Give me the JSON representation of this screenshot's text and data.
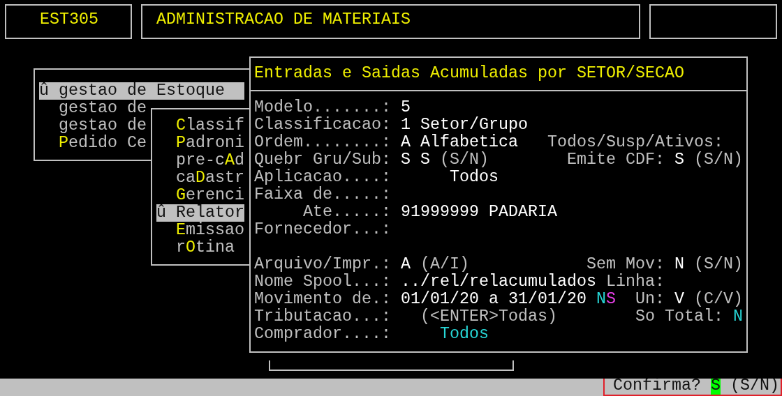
{
  "header": {
    "program_code": "EST305",
    "system_title": "ADMINISTRACAO DE MATERIAIS"
  },
  "main_menu": {
    "items": [
      {
        "selected": true,
        "marker": "û",
        "text": "gestao de Estoque"
      },
      {
        "selected": false,
        "text": "gestao de"
      },
      {
        "selected": false,
        "text": "gestao de"
      },
      {
        "selected": false,
        "key": "P",
        "text": "edido Ce"
      }
    ]
  },
  "sub_menu": {
    "items": [
      {
        "selected": false,
        "key": "C",
        "text": "lassif"
      },
      {
        "selected": false,
        "key": "P",
        "text": "adroni"
      },
      {
        "selected": false,
        "before": "pre-c",
        "key": "A",
        "text": "d"
      },
      {
        "selected": false,
        "before": "ca",
        "key": "D",
        "text": "astr"
      },
      {
        "selected": false,
        "key": "G",
        "text": "erenci"
      },
      {
        "selected": true,
        "marker": "û",
        "text": "Relator"
      },
      {
        "selected": false,
        "key": "E",
        "text": "missao"
      },
      {
        "selected": false,
        "before": "r",
        "key": "O",
        "text": "tina"
      }
    ]
  },
  "dialog": {
    "title": "Entradas e Saidas Acumuladas por SETOR/SECAO",
    "sections": [
      {
        "rows": [
          {
            "segments": [
              {
                "kind": "label",
                "text": "Modelo.......:"
              },
              {
                "kind": "value",
                "text": "5"
              }
            ]
          },
          {
            "segments": [
              {
                "kind": "label",
                "text": "Classificacao:"
              },
              {
                "kind": "value",
                "text": "1 Setor/Grupo"
              }
            ]
          },
          {
            "segments": [
              {
                "kind": "label",
                "text": "Ordem........:"
              },
              {
                "kind": "value",
                "text": "A Alfabetica"
              },
              {
                "kind": "label",
                "text": "Todos/Susp/Ativos:"
              }
            ]
          },
          {
            "segments": [
              {
                "kind": "label",
                "text": "Quebr Gru/Sub:"
              },
              {
                "kind": "value",
                "text": "S S"
              },
              {
                "kind": "hint",
                "text": "(S/N)"
              },
              {
                "kind": "label",
                "text": "Emite CDF:"
              },
              {
                "kind": "value",
                "text": "S"
              },
              {
                "kind": "hint",
                "text": "(S/N)"
              }
            ]
          },
          {
            "segments": [
              {
                "kind": "label",
                "text": "Aplicacao....:"
              },
              {
                "kind": "value",
                "text": "Todos"
              }
            ]
          },
          {
            "segments": [
              {
                "kind": "label",
                "text": "Faixa de.....:"
              }
            ]
          },
          {
            "segments": [
              {
                "kind": "label",
                "text": "Ate.....:"
              },
              {
                "kind": "value",
                "text": "91999999 PADARIA"
              }
            ]
          },
          {
            "segments": [
              {
                "kind": "label",
                "text": "Fornecedor...:"
              }
            ]
          }
        ]
      },
      {
        "rows": [
          {
            "segments": [
              {
                "kind": "label",
                "text": "Arquivo/Impr.:"
              },
              {
                "kind": "value",
                "text": "A"
              },
              {
                "kind": "hint",
                "text": "(A/I)"
              },
              {
                "kind": "label",
                "text": "Sem Mov:"
              },
              {
                "kind": "value",
                "text": "N"
              },
              {
                "kind": "hint",
                "text": "(S/N)"
              }
            ]
          },
          {
            "segments": [
              {
                "kind": "label",
                "text": "Nome Spool...:"
              },
              {
                "kind": "value",
                "text": "../rel/relacumulados"
              },
              {
                "kind": "label",
                "text": "Linha:"
              }
            ]
          },
          {
            "segments": [
              {
                "kind": "label",
                "text": "Movimento de.:"
              },
              {
                "kind": "value",
                "text": "01/01/20 a 31/01/20"
              },
              {
                "kind": "flags",
                "parts": [
                  {
                    "text": "N",
                    "color": "#27d7d7"
                  },
                  {
                    "text": "S",
                    "color": "#e63ee6"
                  }
                ]
              },
              {
                "kind": "label",
                "text": "Un:"
              },
              {
                "kind": "value",
                "text": "V"
              },
              {
                "kind": "hint",
                "text": "(C/V)"
              }
            ]
          },
          {
            "segments": [
              {
                "kind": "label",
                "text": "Tributacao...:"
              },
              {
                "kind": "hint",
                "text": "(<ENTER>Todas)"
              },
              {
                "kind": "label",
                "text": "So Total:"
              },
              {
                "kind": "accent",
                "text": "N"
              }
            ]
          },
          {
            "segments": [
              {
                "kind": "label",
                "text": "Comprador....:"
              },
              {
                "kind": "accent",
                "text": "Todos"
              }
            ]
          }
        ]
      }
    ]
  },
  "status_bar": {
    "prompt": "Confirma?",
    "answer": "S",
    "hint": "(S/N)",
    "highlighted": true
  }
}
